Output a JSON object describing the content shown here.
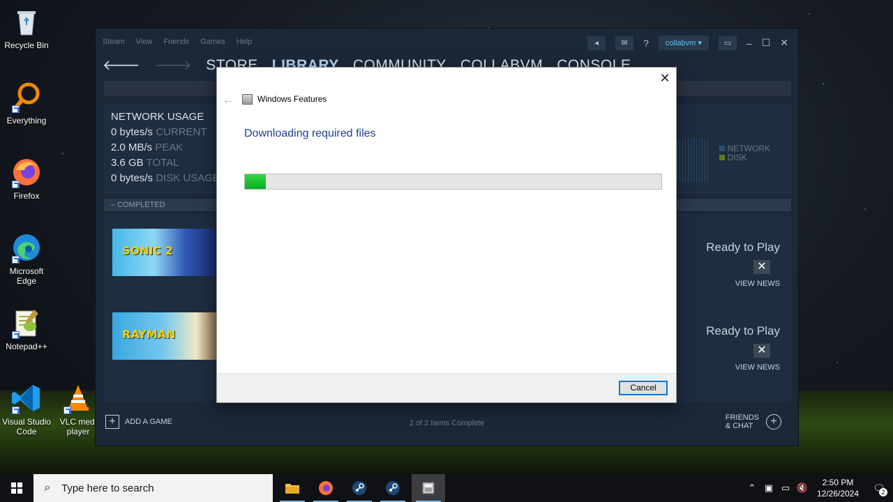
{
  "desktop": {
    "icons": [
      {
        "label": "Recycle Bin"
      },
      {
        "label": "Everything"
      },
      {
        "label": "Firefox"
      },
      {
        "label": "Microsoft Edge"
      },
      {
        "label": "Notepad++"
      },
      {
        "label": "Visual Studio Code"
      },
      {
        "label": "VLC medi player"
      }
    ]
  },
  "steam": {
    "menu": [
      "Steam",
      "View",
      "Friends",
      "Games",
      "Help"
    ],
    "account": "collabvm",
    "help_glyph": "?",
    "nav": {
      "store": "STORE",
      "library": "LIBRARY",
      "community": "COMMUNITY",
      "collabvm": "COLLABVM",
      "console": "CONSOLE"
    },
    "network": {
      "title": "NETWORK USAGE",
      "current_value": "0 bytes/s",
      "current_label": "CURRENT",
      "peak_value": "2.0 MB/s",
      "peak_label": "PEAK",
      "total_value": "3.6 GB",
      "total_label": "TOTAL",
      "disk_value": "0 bytes/s",
      "disk_label": "DISK USAGE",
      "legend_network": "NETWORK",
      "legend_disk": "DISK",
      "network_color": "#2c4f78",
      "disk_color": "#5c7e10"
    },
    "completed_label": "–  COMPLETED",
    "games": [
      {
        "thumb_text": "SONIC 2",
        "status": "Ready to Play",
        "remove": "✕",
        "view_news": "VIEW NEWS"
      },
      {
        "thumb_text": "RAYMAN",
        "status": "Ready to Play",
        "remove": "✕",
        "view_news": "VIEW NEWS"
      }
    ],
    "add_game": "ADD A GAME",
    "items_complete": "2 of 2 Items Complete",
    "friends_line1": "FRIENDS",
    "friends_line2": "& CHAT"
  },
  "dialog": {
    "title": "Windows Features",
    "heading": "Downloading required files",
    "progress": 0.05,
    "cancel": "Cancel",
    "close": "✕"
  },
  "taskbar": {
    "search_placeholder": "Type here to search",
    "time": "2:50 PM",
    "date": "12/26/2024",
    "notification_count": "2"
  },
  "colors": {
    "accent": "#0078d7",
    "progress_green": "#06b025",
    "steam_bg": "#1b2838"
  }
}
